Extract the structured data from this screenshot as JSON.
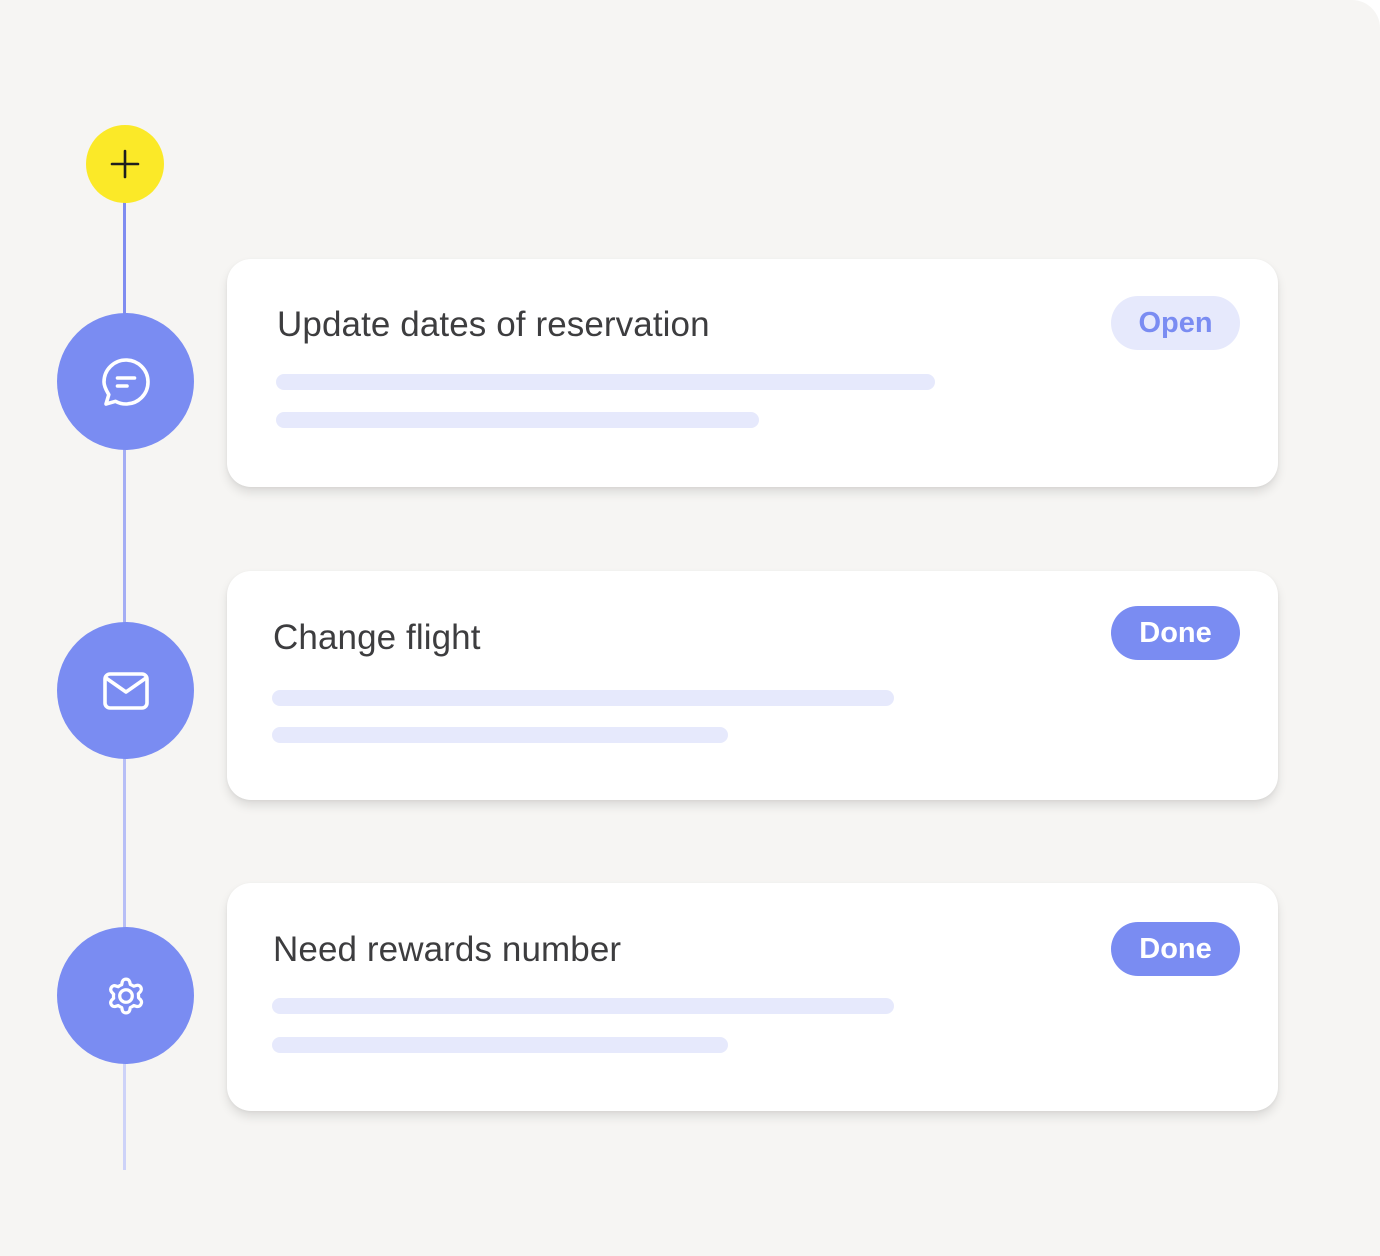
{
  "timeline": {
    "add_button_icon": "plus-icon",
    "items": [
      {
        "icon": "chat-bubble-icon",
        "title": "Update dates of reservation",
        "status": "Open"
      },
      {
        "icon": "mail-icon",
        "title": "Change flight",
        "status": "Done"
      },
      {
        "icon": "gear-icon",
        "title": "Need rewards number",
        "status": "Done"
      }
    ]
  },
  "colors": {
    "background": "#f6f5f3",
    "accent": "#7a8cf2",
    "accent_light": "#e6e9fc",
    "add_button": "#fbe928",
    "card": "#ffffff",
    "title_text": "#3d3d3f"
  }
}
